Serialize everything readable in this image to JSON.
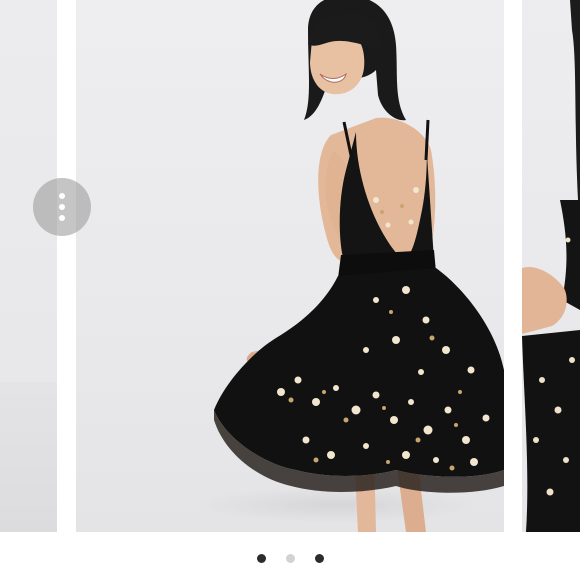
{
  "carousel": {
    "menu_icon": "more-vertical-icon",
    "slides": [
      {
        "id": "previous-slide",
        "content": "studio-photo-partial"
      },
      {
        "id": "current-slide",
        "content": "model-black-floral-embroidered-dress"
      },
      {
        "id": "next-slide",
        "content": "studio-photo-partial"
      }
    ],
    "pagination": {
      "count": 3,
      "active_index": 2,
      "active_color": "#2c2c2c",
      "inactive_color": "#d2d2d2"
    }
  }
}
